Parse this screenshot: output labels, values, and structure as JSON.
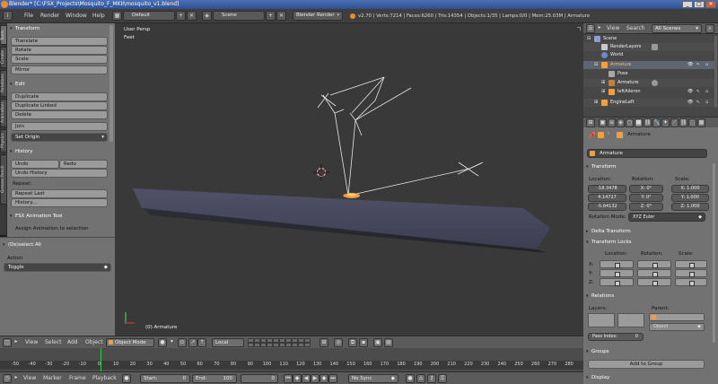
{
  "title_bar": {
    "title": "Blender* [C:\\FSX_Projects\\Mosquito_F_MKII\\mosquito_v1.blend]",
    "min": "_",
    "max": "□",
    "close": "✕"
  },
  "info_header": {
    "menus": [
      "File",
      "Render",
      "Window",
      "Help"
    ],
    "screen_layout": "Default",
    "scene": "Scene",
    "engine": "Blender Render",
    "stats": "v2.70 | Verts:7214 | Faces:6260 | Tris:14354 | Objects:1/35 | Lamps:0/0 | Mem:25.03M | Armature"
  },
  "left_tabs": [
    "Tools",
    "Create",
    "Relations",
    "Animation",
    "Physics",
    "Grease Pencil"
  ],
  "tool_shelf": {
    "transform_header": "Transform",
    "transform_buttons": [
      "Translate",
      "Rotate",
      "Scale"
    ],
    "mirror": "Mirror",
    "edit_header": "Edit",
    "edit_buttons": [
      "Duplicate",
      "Duplicate Linked",
      "Delete"
    ],
    "join": "Join",
    "set_origin": "Set Origin",
    "history_header": "History",
    "undo": "Undo",
    "redo": "Redo",
    "undo_history": "Undo History",
    "repeat_label": "Repeat:",
    "repeat_last": "Repeat Last",
    "history": "History...",
    "fsx_header": "FSX Animation Tool",
    "assign_text": "Assign Animation to selection"
  },
  "operator_panel": {
    "header": "(De)select All",
    "action_label": "Action",
    "action_value": "Toggle"
  },
  "viewport": {
    "view_name": "User Persp",
    "units": "Feet",
    "object_label": "(0) Armature"
  },
  "view3d_header": {
    "menus": [
      "View",
      "Select",
      "Add",
      "Object"
    ],
    "mode": "Object Mode",
    "orientation": "Local"
  },
  "timeline": {
    "ticks": [
      "-50",
      "-40",
      "-30",
      "-20",
      "-10",
      "0",
      "10",
      "20",
      "30",
      "40",
      "50",
      "60",
      "70",
      "80",
      "90",
      "100",
      "110",
      "120",
      "130",
      "140",
      "150",
      "160",
      "170",
      "180",
      "190",
      "200",
      "210",
      "220",
      "230",
      "240",
      "250",
      "260",
      "270",
      "280"
    ],
    "menus": [
      "View",
      "Marker",
      "Frame",
      "Playback"
    ],
    "start_label": "Start:",
    "start_value": "0",
    "end_label": "End:",
    "end_value": "100",
    "current_frame": "0",
    "sync": "No Sync"
  },
  "outliner": {
    "view": "View",
    "search": "Search",
    "filter": "All Scenes",
    "rows": [
      {
        "label": "Scene",
        "indent": 0
      },
      {
        "label": "RenderLayers",
        "indent": 1
      },
      {
        "label": "World",
        "indent": 1
      },
      {
        "label": "Armature",
        "indent": 1
      },
      {
        "label": "Pose",
        "indent": 2
      },
      {
        "label": "Armature",
        "indent": 2
      },
      {
        "label": "leftAileron",
        "indent": 2
      },
      {
        "label": "EngineLeft",
        "indent": 1
      }
    ]
  },
  "properties": {
    "breadcrumb": "Armature",
    "object_name": "Armature",
    "transform_header": "Transform",
    "location_label": "Location:",
    "rotation_label": "Rotation:",
    "scale_label": "Scale:",
    "location": [
      "-18.3478",
      "4.14727",
      "-5.64132"
    ],
    "rotation": [
      "X: 0°",
      "Y: 0°",
      "Z: 0°"
    ],
    "scale": [
      "X: 1.000",
      "Y: 1.000",
      "Z: 1.000"
    ],
    "rotation_mode_label": "Rotation Mode:",
    "rotation_mode": "XYZ Euler",
    "delta_header": "Delta Transform",
    "locks_header": "Transform Locks",
    "locks_location": "Location:",
    "locks_rotation": "Rotation:",
    "locks_scale": "Scale:",
    "axes": [
      "X:",
      "Y:",
      "Z:"
    ],
    "relations_header": "Relations",
    "layers_label": "Layers:",
    "parent_label": "Parent:",
    "parent_type": "Object",
    "pass_index": "Pass Index:",
    "pass_index_value": "0",
    "groups_header": "Groups",
    "add_to_group": "Add to Group",
    "display_header": "Display"
  },
  "colors": {
    "viewport_bg": "#393939",
    "panel_bg": "#727272",
    "selected_orange": "#f0a040",
    "wing_color": "#4a4a60"
  }
}
